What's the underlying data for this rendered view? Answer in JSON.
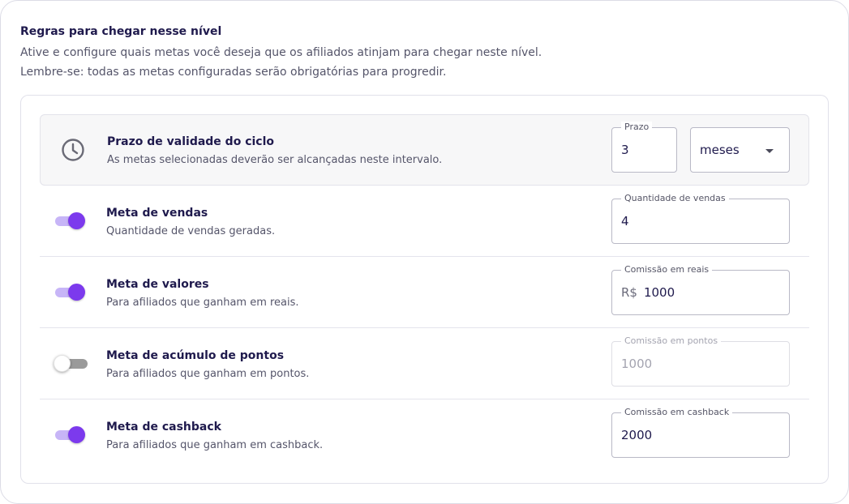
{
  "header": {
    "title": "Regras para chegar nesse nível",
    "description_line1": "Ative e configure quais metas você deseja que os afiliados atinjam para chegar neste nível.",
    "description_line2": "Lembre-se: todas as metas configuradas serão obrigatórias para progredir."
  },
  "cycle": {
    "icon": "clock-icon",
    "title": "Prazo de validade do ciclo",
    "subtitle": "As metas selecionadas deverão ser alcançadas neste intervalo.",
    "deadline_label": "Prazo",
    "deadline_value": "3",
    "unit_value": "meses"
  },
  "goals": [
    {
      "enabled": true,
      "title": "Meta de vendas",
      "subtitle": "Quantidade de vendas geradas.",
      "field_label": "Quantidade de vendas",
      "field_prefix": "",
      "field_value": "4"
    },
    {
      "enabled": true,
      "title": "Meta de valores",
      "subtitle": "Para afiliados que ganham em reais.",
      "field_label": "Comissão em reais",
      "field_prefix": "R$",
      "field_value": "1000"
    },
    {
      "enabled": false,
      "title": "Meta de acúmulo de pontos",
      "subtitle": "Para afiliados que ganham em pontos.",
      "field_label": "Comissão em pontos",
      "field_prefix": "",
      "field_value": "1000"
    },
    {
      "enabled": true,
      "title": "Meta de cashback",
      "subtitle": "Para afiliados que ganham em cashback.",
      "field_label": "Comissão em cashback",
      "field_prefix": "",
      "field_value": "2000"
    }
  ],
  "colors": {
    "accent": "#7c3aed",
    "accent_light": "#c7b5f7",
    "title": "#1f1a4d"
  }
}
